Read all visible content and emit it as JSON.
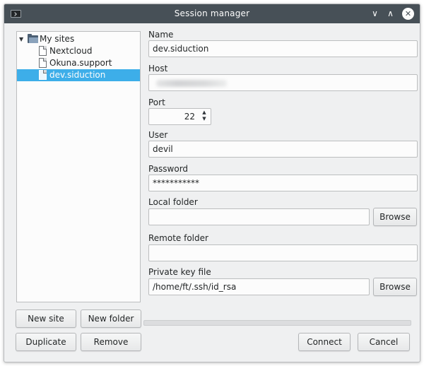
{
  "window": {
    "title": "Session manager"
  },
  "tree": {
    "root": "My sites",
    "items": [
      {
        "label": "Nextcloud"
      },
      {
        "label": "Okuna.support"
      },
      {
        "label": "dev.siduction"
      }
    ],
    "selected": "dev.siduction"
  },
  "form": {
    "name_label": "Name",
    "name_value": "dev.siduction",
    "host_label": "Host",
    "host_value": "",
    "port_label": "Port",
    "port_value": "22",
    "user_label": "User",
    "user_value": "devil",
    "password_label": "Password",
    "password_value": "***********",
    "local_folder_label": "Local folder",
    "local_folder_value": "",
    "remote_folder_label": "Remote folder",
    "remote_folder_value": "",
    "private_key_label": "Private key file",
    "private_key_value": "/home/ft/.ssh/id_rsa",
    "browse_label": "Browse"
  },
  "buttons": {
    "new_site": "New site",
    "new_folder": "New folder",
    "duplicate": "Duplicate",
    "remove": "Remove",
    "connect": "Connect",
    "cancel": "Cancel"
  },
  "icons": {
    "window_menu": "window-menu-icon",
    "minimize": "chevron-down-icon",
    "maximize": "chevron-up-icon",
    "close": "close-icon",
    "folder": "folder-open-icon",
    "file": "file-icon"
  },
  "colors": {
    "titlebar": "#475057",
    "selection": "#3daee9",
    "window_bg": "#eff0f1"
  }
}
